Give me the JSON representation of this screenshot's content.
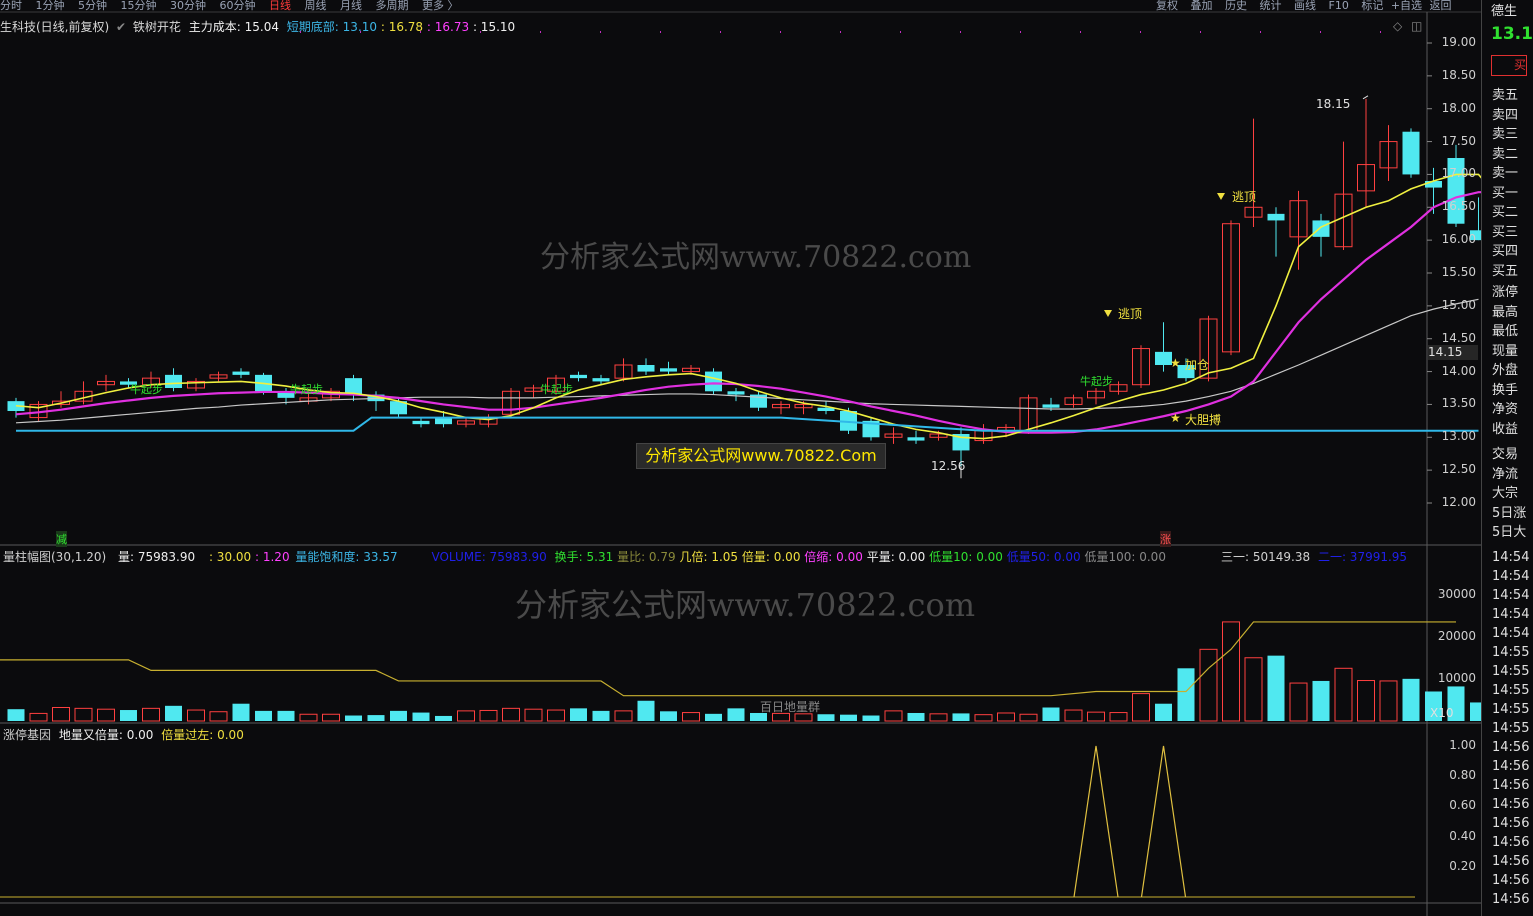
{
  "topbar": {
    "periods": [
      "分时",
      "1分钟",
      "5分钟",
      "15分钟",
      "30分钟",
      "60分钟",
      "日线",
      "周线",
      "月线",
      "多周期",
      "更多 〉"
    ],
    "active_index": 6,
    "tools": [
      "复权",
      "叠加",
      "历史",
      "统计",
      "画线",
      "F10",
      "标记",
      "+自选",
      "返回"
    ]
  },
  "main_info": {
    "title": "生科技(日线,前复权)",
    "indicator": "铁树开花",
    "cost_label": "主力成本: 15.04",
    "bottom_label": "短期底部:",
    "v1": "13.10",
    "v2": ": 16.78",
    "v3": ": 16.73",
    "v4": ": 15.10"
  },
  "right_panel": {
    "name": "德生",
    "price": "13.1",
    "buy_btn": "买",
    "items": [
      "卖五",
      "卖四",
      "卖三",
      "卖二",
      "卖一",
      "买一",
      "买二",
      "买三",
      "买四",
      "买五",
      "涨停",
      "最高",
      "最低",
      "现量",
      "外盘",
      "换手",
      "净资",
      "收益",
      "交易",
      "净流",
      "大宗",
      "5日涨",
      "5日大"
    ],
    "times": [
      "14:54",
      "14:54",
      "14:54",
      "14:54",
      "14:54",
      "14:55",
      "14:55",
      "14:55",
      "14:55",
      "14:55",
      "14:56",
      "14:56",
      "14:56",
      "14:56",
      "14:56",
      "14:56",
      "14:56",
      "14:56",
      "14:56"
    ]
  },
  "price_axis": [
    "19.00",
    "18.50",
    "18.00",
    "17.50",
    "17.00",
    "16.50",
    "16.00",
    "15.50",
    "15.00",
    "14.50",
    "14.00",
    "13.50",
    "13.00",
    "12.50",
    "12.00"
  ],
  "current_price_tag": "14.15",
  "annotations": {
    "high": "18.15",
    "low": "12.56",
    "escape_top_1": "逃顶",
    "escape_top_2": "逃顶",
    "add_position": "加仓",
    "bold_catch": "大胆搏",
    "cow_start": "牛起步",
    "reduce": "减",
    "rise": "涨",
    "volume_note": "百日地量群"
  },
  "watermarks": {
    "main": "分析家公式网www.70822.com",
    "box": "分析家公式网www.70822.Com",
    "vol": "分析家公式网www.70822.com"
  },
  "vol_info": {
    "title": "量柱幅图(30,1.20)",
    "vol": "量: 75983.90",
    "p1": ": 30.00",
    "p2": ": 1.20",
    "saturation": "量能饱和度: 33.57",
    "volume_label": "VOLUME: 75983.90",
    "turnover": "换手: 5.31",
    "ratio": "量比: 0.79",
    "times": "几倍: 1.05",
    "bei": "倍量: 0.00",
    "beisuo": "倍缩: 0.00",
    "ping": "平量: 0.00",
    "low10": "低量10: 0.00",
    "low50": "低量50: 0.00",
    "low100": "低量100: 0.00",
    "sanyi": "三一: 50149.38",
    "eryi": "二一: 37991.95",
    "x10": "X10"
  },
  "vol_axis": [
    "30000",
    "20000",
    "10000"
  ],
  "sub_info": {
    "title": "涨停基因",
    "a": "地量又倍量: 0.00",
    "b": "倍量过左: 0.00"
  },
  "sub_axis": [
    "1.00",
    "0.80",
    "0.60",
    "0.40",
    "0.20"
  ],
  "chart_data": {
    "type": "candlestick",
    "y_range_price": [
      11.75,
      19.2
    ],
    "candles": [
      {
        "o": 13.55,
        "h": 13.6,
        "l": 13.3,
        "c": 13.4
      },
      {
        "o": 13.3,
        "h": 13.55,
        "l": 13.25,
        "c": 13.5
      },
      {
        "o": 13.5,
        "h": 13.7,
        "l": 13.45,
        "c": 13.55
      },
      {
        "o": 13.55,
        "h": 13.85,
        "l": 13.5,
        "c": 13.7
      },
      {
        "o": 13.8,
        "h": 13.95,
        "l": 13.7,
        "c": 13.85
      },
      {
        "o": 13.85,
        "h": 13.9,
        "l": 13.75,
        "c": 13.8
      },
      {
        "o": 13.8,
        "h": 14.0,
        "l": 13.75,
        "c": 13.9
      },
      {
        "o": 13.95,
        "h": 14.05,
        "l": 13.7,
        "c": 13.75
      },
      {
        "o": 13.75,
        "h": 13.9,
        "l": 13.7,
        "c": 13.85
      },
      {
        "o": 13.9,
        "h": 14.0,
        "l": 13.85,
        "c": 13.95
      },
      {
        "o": 14.0,
        "h": 14.05,
        "l": 13.9,
        "c": 13.95
      },
      {
        "o": 13.95,
        "h": 13.98,
        "l": 13.65,
        "c": 13.7
      },
      {
        "o": 13.7,
        "h": 13.75,
        "l": 13.5,
        "c": 13.6
      },
      {
        "o": 13.55,
        "h": 13.7,
        "l": 13.5,
        "c": 13.6
      },
      {
        "o": 13.6,
        "h": 13.75,
        "l": 13.55,
        "c": 13.7
      },
      {
        "o": 13.9,
        "h": 13.95,
        "l": 13.55,
        "c": 13.65
      },
      {
        "o": 13.65,
        "h": 13.7,
        "l": 13.4,
        "c": 13.55
      },
      {
        "o": 13.55,
        "h": 13.6,
        "l": 13.3,
        "c": 13.35
      },
      {
        "o": 13.25,
        "h": 13.3,
        "l": 13.15,
        "c": 13.2
      },
      {
        "o": 13.3,
        "h": 13.4,
        "l": 13.15,
        "c": 13.2
      },
      {
        "o": 13.2,
        "h": 13.3,
        "l": 13.15,
        "c": 13.25
      },
      {
        "o": 13.2,
        "h": 13.35,
        "l": 13.15,
        "c": 13.3
      },
      {
        "o": 13.35,
        "h": 13.75,
        "l": 13.3,
        "c": 13.7
      },
      {
        "o": 13.7,
        "h": 13.8,
        "l": 13.6,
        "c": 13.75
      },
      {
        "o": 13.7,
        "h": 13.95,
        "l": 13.65,
        "c": 13.9
      },
      {
        "o": 13.95,
        "h": 14.0,
        "l": 13.85,
        "c": 13.9
      },
      {
        "o": 13.9,
        "h": 13.95,
        "l": 13.8,
        "c": 13.85
      },
      {
        "o": 13.9,
        "h": 14.2,
        "l": 13.85,
        "c": 14.1
      },
      {
        "o": 14.1,
        "h": 14.2,
        "l": 13.95,
        "c": 14.0
      },
      {
        "o": 14.05,
        "h": 14.15,
        "l": 13.95,
        "c": 14.0
      },
      {
        "o": 14.0,
        "h": 14.1,
        "l": 13.95,
        "c": 14.05
      },
      {
        "o": 14.0,
        "h": 14.05,
        "l": 13.65,
        "c": 13.7
      },
      {
        "o": 13.7,
        "h": 13.75,
        "l": 13.55,
        "c": 13.65
      },
      {
        "o": 13.65,
        "h": 13.7,
        "l": 13.4,
        "c": 13.45
      },
      {
        "o": 13.45,
        "h": 13.55,
        "l": 13.35,
        "c": 13.5
      },
      {
        "o": 13.45,
        "h": 13.55,
        "l": 13.35,
        "c": 13.5
      },
      {
        "o": 13.45,
        "h": 13.55,
        "l": 13.35,
        "c": 13.4
      },
      {
        "o": 13.4,
        "h": 13.45,
        "l": 13.05,
        "c": 13.1
      },
      {
        "o": 13.25,
        "h": 13.3,
        "l": 12.95,
        "c": 13.0
      },
      {
        "o": 13.0,
        "h": 13.15,
        "l": 12.9,
        "c": 13.05
      },
      {
        "o": 13.0,
        "h": 13.1,
        "l": 12.9,
        "c": 12.95
      },
      {
        "o": 13.0,
        "h": 13.1,
        "l": 12.95,
        "c": 13.05
      },
      {
        "o": 13.05,
        "h": 13.15,
        "l": 12.56,
        "c": 12.8
      },
      {
        "o": 12.95,
        "h": 13.2,
        "l": 12.9,
        "c": 13.1
      },
      {
        "o": 13.1,
        "h": 13.2,
        "l": 13.0,
        "c": 13.15
      },
      {
        "o": 13.1,
        "h": 13.65,
        "l": 13.05,
        "c": 13.6
      },
      {
        "o": 13.5,
        "h": 13.6,
        "l": 13.4,
        "c": 13.45
      },
      {
        "o": 13.5,
        "h": 13.65,
        "l": 13.45,
        "c": 13.6
      },
      {
        "o": 13.6,
        "h": 13.75,
        "l": 13.5,
        "c": 13.7
      },
      {
        "o": 13.7,
        "h": 13.85,
        "l": 13.65,
        "c": 13.8
      },
      {
        "o": 13.8,
        "h": 14.4,
        "l": 13.75,
        "c": 14.35
      },
      {
        "o": 14.3,
        "h": 14.75,
        "l": 14.0,
        "c": 14.1
      },
      {
        "o": 14.1,
        "h": 14.2,
        "l": 13.85,
        "c": 13.9
      },
      {
        "o": 13.9,
        "h": 14.85,
        "l": 13.85,
        "c": 14.8
      },
      {
        "o": 14.3,
        "h": 16.3,
        "l": 14.25,
        "c": 16.25
      },
      {
        "o": 16.35,
        "h": 17.85,
        "l": 16.2,
        "c": 16.5
      },
      {
        "o": 16.4,
        "h": 16.5,
        "l": 15.75,
        "c": 16.3
      },
      {
        "o": 16.05,
        "h": 16.75,
        "l": 15.55,
        "c": 16.6
      },
      {
        "o": 16.3,
        "h": 16.4,
        "l": 15.75,
        "c": 16.05
      },
      {
        "o": 15.9,
        "h": 17.5,
        "l": 15.85,
        "c": 16.7
      },
      {
        "o": 16.75,
        "h": 18.15,
        "l": 16.5,
        "c": 17.15
      },
      {
        "o": 17.1,
        "h": 17.75,
        "l": 16.9,
        "c": 17.5
      },
      {
        "o": 17.65,
        "h": 17.7,
        "l": 16.95,
        "c": 17.0
      },
      {
        "o": 16.9,
        "h": 17.1,
        "l": 16.4,
        "c": 16.8
      },
      {
        "o": 17.25,
        "h": 17.45,
        "l": 16.2,
        "c": 16.25
      },
      {
        "o": 16.15,
        "h": 16.65,
        "l": 16.0,
        "c": 16.0
      }
    ],
    "ma_yellow": [
      13.48,
      13.45,
      13.52,
      13.6,
      13.68,
      13.75,
      13.8,
      13.82,
      13.83,
      13.84,
      13.85,
      13.82,
      13.78,
      13.72,
      13.68,
      13.67,
      13.62,
      13.55,
      13.45,
      13.38,
      13.3,
      13.27,
      13.33,
      13.45,
      13.6,
      13.72,
      13.8,
      13.88,
      13.92,
      13.95,
      13.97,
      13.9,
      13.82,
      13.7,
      13.6,
      13.52,
      13.47,
      13.4,
      13.3,
      13.2,
      13.12,
      13.07,
      13.0,
      12.98,
      13.02,
      13.12,
      13.22,
      13.33,
      13.45,
      13.55,
      13.65,
      13.72,
      13.82,
      13.98,
      14.05,
      14.2,
      15.0,
      15.9,
      16.2,
      16.35,
      16.5,
      16.6,
      16.78,
      16.9,
      17.0,
      17.0,
      16.6
    ],
    "ma_magenta": [
      13.35,
      13.38,
      13.42,
      13.47,
      13.52,
      13.56,
      13.6,
      13.63,
      13.65,
      13.67,
      13.68,
      13.69,
      13.69,
      13.68,
      13.66,
      13.65,
      13.63,
      13.6,
      13.55,
      13.5,
      13.46,
      13.42,
      13.42,
      13.45,
      13.5,
      13.55,
      13.6,
      13.66,
      13.72,
      13.77,
      13.8,
      13.82,
      13.81,
      13.78,
      13.74,
      13.68,
      13.62,
      13.55,
      13.47,
      13.4,
      13.33,
      13.25,
      13.18,
      13.12,
      13.08,
      13.07,
      13.07,
      13.08,
      13.12,
      13.18,
      13.25,
      13.32,
      13.4,
      13.5,
      13.62,
      13.85,
      14.3,
      14.75,
      15.1,
      15.4,
      15.7,
      15.95,
      16.2,
      16.5,
      16.65,
      16.73,
      16.73
    ],
    "ma_white": [
      13.22,
      13.24,
      13.26,
      13.29,
      13.32,
      13.35,
      13.38,
      13.41,
      13.44,
      13.46,
      13.49,
      13.51,
      13.53,
      13.55,
      13.57,
      13.58,
      13.59,
      13.6,
      13.61,
      13.61,
      13.61,
      13.6,
      13.6,
      13.6,
      13.61,
      13.62,
      13.63,
      13.64,
      13.65,
      13.66,
      13.66,
      13.65,
      13.63,
      13.61,
      13.59,
      13.57,
      13.55,
      13.53,
      13.51,
      13.5,
      13.49,
      13.48,
      13.47,
      13.46,
      13.45,
      13.44,
      13.43,
      13.43,
      13.44,
      13.45,
      13.47,
      13.5,
      13.55,
      13.62,
      13.7,
      13.82,
      13.96,
      14.1,
      14.25,
      14.4,
      14.55,
      14.7,
      14.85,
      14.95,
      15.03,
      15.1
    ],
    "support_line": [
      [
        0,
        13.1
      ],
      [
        15,
        13.1
      ],
      [
        15.8,
        13.3
      ],
      [
        30,
        13.3
      ],
      [
        34,
        13.3
      ],
      [
        43,
        13.1
      ],
      [
        65,
        13.1
      ]
    ],
    "volume_y_range": [
      0,
      37000
    ],
    "volumes": [
      2800,
      1800,
      3200,
      3000,
      2800,
      2600,
      3000,
      3600,
      2600,
      2200,
      4100,
      2400,
      2400,
      1600,
      1600,
      1300,
      1400,
      2400,
      2000,
      1200,
      2400,
      2500,
      3000,
      2800,
      2600,
      3000,
      2400,
      2400,
      4800,
      2300,
      2000,
      1700,
      3000,
      1900,
      1800,
      1700,
      1600,
      1500,
      1300,
      2400,
      1900,
      1700,
      1800,
      1500,
      1900,
      1600,
      3200,
      2600,
      2100,
      2000,
      6500,
      4100,
      12500,
      17000,
      23500,
      15000,
      15500,
      9000,
      9500,
      12500,
      9600,
      9500,
      10000,
      7000,
      8200,
      4400
    ],
    "vol_line": [
      [
        0,
        14500
      ],
      [
        5,
        14500
      ],
      [
        6,
        12000
      ],
      [
        16,
        12000
      ],
      [
        17,
        9500
      ],
      [
        26,
        9500
      ],
      [
        27,
        6000
      ],
      [
        46,
        6000
      ],
      [
        48,
        7000
      ],
      [
        52,
        7000
      ],
      [
        53,
        12500
      ],
      [
        54,
        17000
      ],
      [
        55,
        23500
      ],
      [
        64,
        23500
      ]
    ],
    "sub_peaks": [
      [
        48,
        1.0
      ],
      [
        51,
        1.0
      ]
    ],
    "sub_y_range": [
      0,
      1.1
    ]
  }
}
